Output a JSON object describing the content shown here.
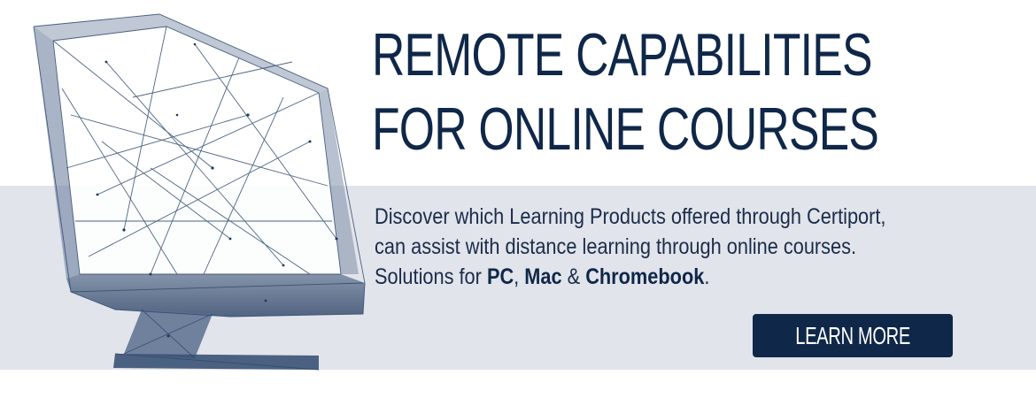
{
  "headline": {
    "line1": "REMOTE CAPABILITIES",
    "line2": "FOR ONLINE COURSES"
  },
  "body": {
    "line1": "Discover which Learning Products offered through Certiport,",
    "line2": "can assist with distance learning through online courses.",
    "line3_prefix": "Solutions for ",
    "platform_pc": "PC",
    "sep1": ", ",
    "platform_mac": "Mac",
    "sep2": " & ",
    "platform_chromebook": "Chromebook",
    "line3_suffix": "."
  },
  "cta": {
    "label": "LEARN MORE"
  },
  "colors": {
    "navy": "#0f2748",
    "band": "#e2e4eb",
    "background": "#ffffff"
  },
  "illustration": {
    "icon": "wireframe-monitor-icon"
  }
}
